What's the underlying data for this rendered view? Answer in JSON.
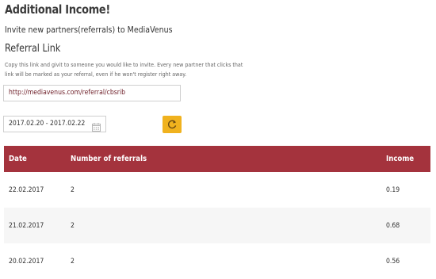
{
  "header": {
    "title": "Additional Income!",
    "subtitle": "Invite new partners(referrals) to MediaVenus"
  },
  "referral": {
    "heading": "Referral Link",
    "description": "Copy this link and givit to someone you would like to invite. Every new partner that clicks that link will be marked as your referral, even if he won't register right away.",
    "link": "http://mediavenus.com/referral/cbsrib"
  },
  "filter": {
    "date_range": "2017.02.20 - 2017.02.22",
    "calendar_icon": "calendar-icon",
    "refresh_icon": "refresh-icon",
    "refresh_color": "#f0b21e"
  },
  "table": {
    "header_color": "#a4333d",
    "columns": [
      "Date",
      "Number of referrals",
      "Income"
    ],
    "rows": [
      {
        "date": "22.02.2017",
        "referrals": "2",
        "income": "0.19"
      },
      {
        "date": "21.02.2017",
        "referrals": "2",
        "income": "0.68"
      },
      {
        "date": "20.02.2017",
        "referrals": "2",
        "income": "0.56"
      }
    ]
  }
}
